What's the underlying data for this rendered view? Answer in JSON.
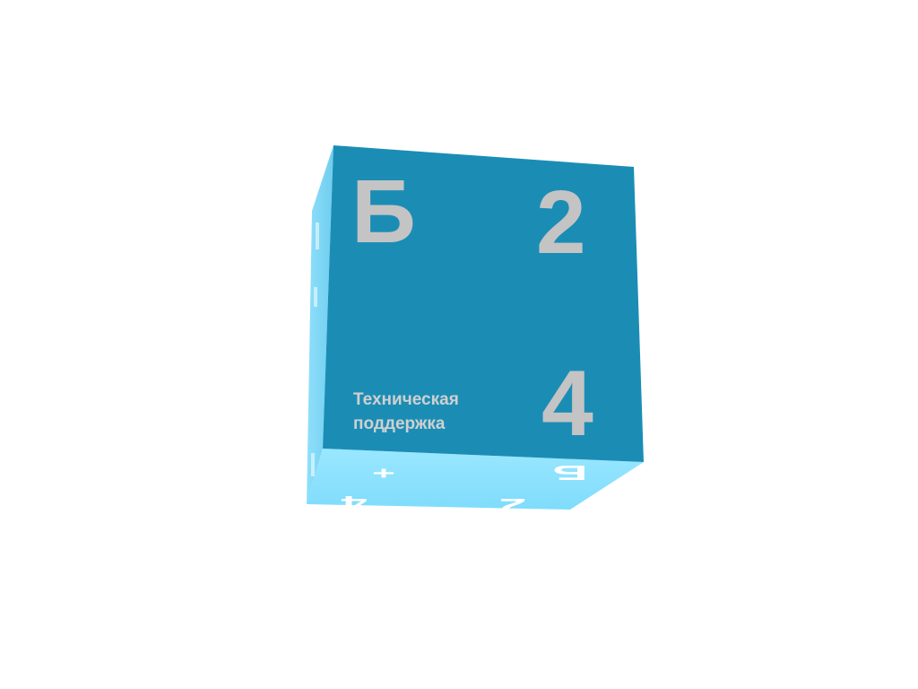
{
  "cube": {
    "colors": {
      "front": "#1b8db5",
      "side": "#7fd6f5",
      "bottom": "#8fe3ff",
      "glyph": "#c9c9c9",
      "side_glyph": "#ffffff"
    },
    "front": {
      "top_left_glyph": "Б",
      "top_right_glyph": "2",
      "bottom_right_glyph": "4",
      "label_line1": "Техническая",
      "label_line2": "поддержка"
    },
    "bottom": {
      "glyph_plus": "+",
      "glyph_b": "Б",
      "glyph_4": "4",
      "glyph_2": "2"
    }
  }
}
